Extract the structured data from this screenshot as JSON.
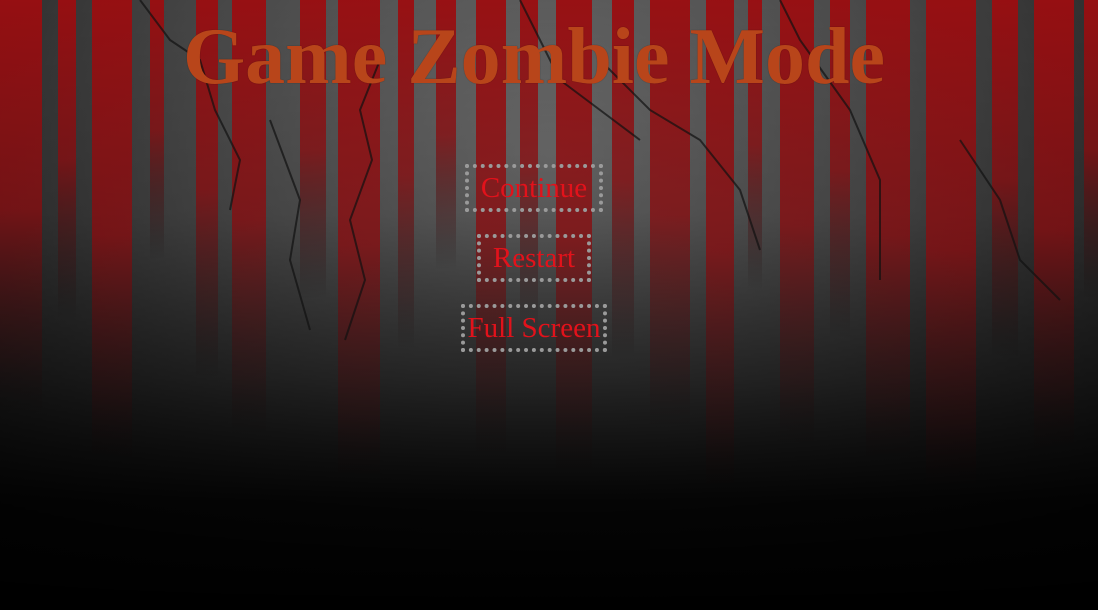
{
  "title": "Game Zombie Mode",
  "menu": {
    "items": [
      {
        "label": "Continue"
      },
      {
        "label": "Restart"
      },
      {
        "label": "Full Screen"
      }
    ]
  },
  "colors": {
    "title": "#b8451a",
    "button_text": "#e2121b",
    "button_border": "#9a9a9a",
    "blood": "#9b0d10"
  }
}
